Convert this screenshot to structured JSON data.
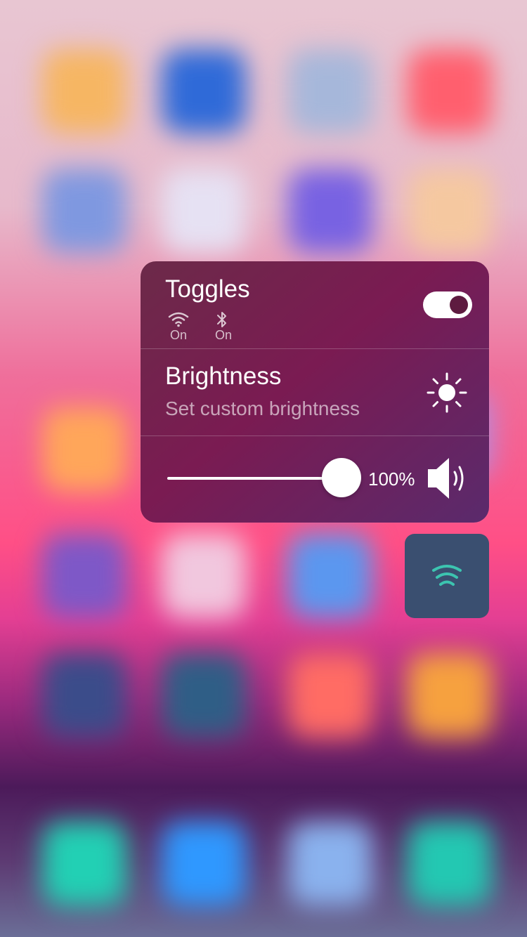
{
  "colors": {
    "panel": "#7a1b52",
    "toggle_on": "#ffffff",
    "widget_bg": "#3a4f70",
    "widget_icon": "#3cc4b0"
  },
  "toggles": {
    "title": "Toggles",
    "wifi": {
      "icon": "wifi-icon",
      "status": "On"
    },
    "bluetooth": {
      "icon": "bluetooth-icon",
      "status": "On"
    },
    "switch_on": true
  },
  "brightness": {
    "title": "Brightness",
    "subtitle": "Set custom brightness",
    "icon": "sun-icon"
  },
  "volume": {
    "level": 1.0,
    "label": "100%",
    "icon": "speaker-icon"
  },
  "widget": {
    "icon": "signal-waves-icon"
  }
}
